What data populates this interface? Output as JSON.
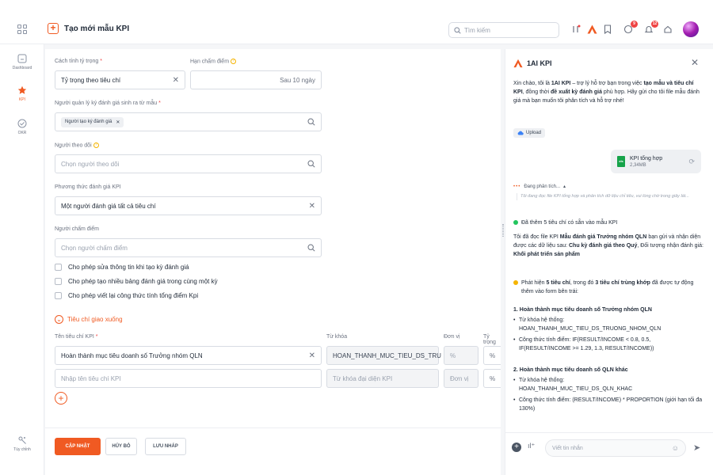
{
  "header": {
    "title": "Tạo mới mẫu KPI",
    "search_placeholder": "Tìm kiếm",
    "notif_badge_1": "9",
    "notif_badge_2": "12"
  },
  "sidebar": {
    "items": [
      {
        "label": "Dashboard",
        "icon": "dashboard-icon"
      },
      {
        "label": "KPI",
        "icon": "star-icon"
      },
      {
        "label": "OKR",
        "icon": "check-circle-icon"
      }
    ],
    "bottom_label": "Tùy chỉnh"
  },
  "form": {
    "weighting": {
      "label": "Cách tính tỷ trọng",
      "value": "Tỷ trọng theo tiêu chí"
    },
    "deadline": {
      "label": "Hạn chấm điểm",
      "value": "Sau 10 ngày"
    },
    "manager": {
      "label": "Người quản lý ký đánh giá sinh ra từ mẫu",
      "tag": "Người tạo ký đánh giá"
    },
    "follower": {
      "label": "Người theo dõi",
      "placeholder": "Chọn người theo dõi"
    },
    "method": {
      "label": "Phương thức đánh giá KPI",
      "value": "Một người đánh giá tất cả tiêu chí"
    },
    "grader": {
      "label": "Người chấm điểm",
      "placeholder": "Chọn người chấm điểm"
    },
    "checkboxes": [
      "Cho phép sửa thông tin khi tạo kỳ đánh giá",
      "Cho phép tạo nhiều bảng đánh giá trong cùng một kỳ",
      "Cho phép viết lại công thức tính tổng điểm Kpi"
    ],
    "section_title": "Tiêu chí giao xuống",
    "columns": {
      "name": "Tên tiêu chí KPI",
      "keyword": "Từ khóa",
      "unit": "Đơn vị",
      "weight": "Tỷ trọng"
    },
    "rows": [
      {
        "name": "Hoàn thành mục tiêu doanh số Trưởng nhóm QLN",
        "keyword": "HOAN_THANH_MUC_TIEU_DS_TRU",
        "unit": "%",
        "weight": "%"
      }
    ],
    "new_row": {
      "name_placeholder": "Nhập tên tiêu chí KPI",
      "keyword_placeholder": "Từ khóa đại diện KPI",
      "unit_placeholder": "Đơn vị",
      "weight": "%"
    },
    "buttons": {
      "update": "CẬP NHẬT",
      "cancel": "HỦY BỎ",
      "draft": "LƯU NHÁP"
    }
  },
  "chat": {
    "title": "1AI KPI",
    "intro_1": "Xin chào, tôi là ",
    "intro_name": "1AI KPI",
    "intro_2": " – trợ lý hỗ trợ bạn trong việc ",
    "intro_bold_1": "tạo mẫu và tiêu chí KPI",
    "intro_3": ", đồng thời ",
    "intro_bold_2": "đề xuất kỳ đánh giá",
    "intro_4": " phù hợp. Hãy gửi cho tôi file mẫu đánh giá mà bạn muốn tôi phân tích và hỗ trợ nhé!",
    "upload_label": "Upload",
    "file_name": "KPI tổng hợp",
    "file_size": "2,34MB",
    "analyzing": "Đang phân tích...",
    "analyzing_note": "Tôi đang đọc file KPI tổng hợp và phân tích dữ liệu chỉ tiêu, vui lòng chờ trong giây lát...",
    "added": "Đã thêm 5 tiêu chí có sẵn vào mẫu KPI",
    "read_1": "Tôi đã đọc file KPI ",
    "read_bold_1": "Mẫu đánh giá Trưởng nhóm QLN",
    "read_2": " bạn gửi và nhận diện được các dữ liệu sau: ",
    "read_bold_2": "Chu kỳ đánh giá theo Quý",
    "read_3": ", Đối tượng nhận đánh giá: ",
    "read_bold_3": "Khối phát triển sản phẩm",
    "found_1": "Phát hiện ",
    "found_bold_1": "5 tiêu chí",
    "found_2": ", trong đó ",
    "found_bold_2": "3 tiêu chí trùng khớp",
    "found_3": " đã được tự động thêm vào form bên trái:",
    "item1_title": "1. Hoàn thành mục tiêu doanh số Trưởng nhóm QLN",
    "item1_kw_label": "Từ khóa hệ thống:",
    "item1_kw": "HOAN_THANH_MUC_TIEU_DS_TRUONG_NHOM_QLN",
    "item1_formula": "Công thức tính điểm: IF(RESULT/INCOME < 0.8, 0.5, IF(RESULT/INCOME >= 1.29, 1.3, RESULT/INCOME))",
    "item2_title": "2. Hoàn thành mục tiêu doanh số QLN khác",
    "item2_kw_label": "Từ khóa hệ thống:",
    "item2_kw": "HOAN_THANH_MUC_TIEU_DS_QLN_KHAC",
    "item2_formula": "Công thức tính điểm: (RESULT/INCOME) * PROPORTION (giới hạn tối đa 130%)",
    "input_placeholder": "Viết tin nhắn"
  },
  "colors": {
    "accent": "#f05a22",
    "success": "#22c55e",
    "warning": "#f5b400"
  }
}
